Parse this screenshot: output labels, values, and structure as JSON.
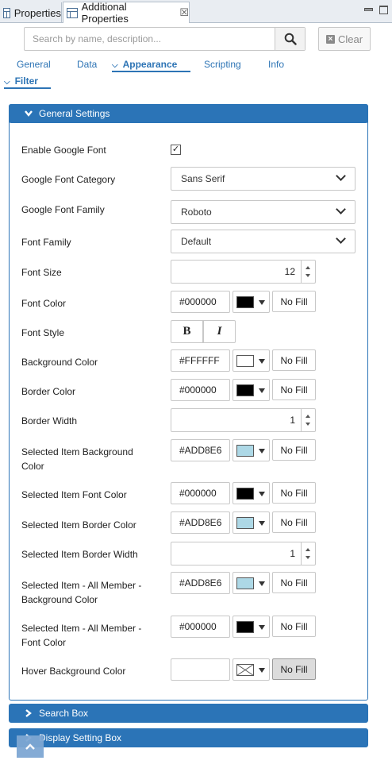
{
  "tabs": [
    {
      "label": "Properties",
      "icon": "properties-icon"
    },
    {
      "label": "Additional Properties",
      "icon": "properties-icon",
      "close": "☒"
    }
  ],
  "search": {
    "placeholder": "Search by name, description...",
    "value": "",
    "clear_label": "Clear"
  },
  "nav": {
    "general": "General",
    "data": "Data",
    "appearance": "Appearance",
    "scripting": "Scripting",
    "info": "Info",
    "filter": "Filter"
  },
  "sections": {
    "general_settings": "General Settings",
    "search_box": "Search Box",
    "display_setting_box": "Display Setting Box"
  },
  "form": {
    "enable_google_font": {
      "label": "Enable Google Font",
      "checked": true,
      "mark": "✓"
    },
    "google_font_category": {
      "label": "Google Font Category",
      "value": "Sans Serif"
    },
    "google_font_family": {
      "label": "Google Font Family",
      "value": "Roboto"
    },
    "font_family": {
      "label": "Font Family",
      "value": "Default"
    },
    "font_size": {
      "label": "Font Size",
      "value": "12"
    },
    "font_color": {
      "label": "Font Color",
      "hex": "#000000",
      "swatch": "#000000",
      "nofill": "No Fill"
    },
    "font_style": {
      "label": "Font Style",
      "bold": "B",
      "italic": "I"
    },
    "background_color": {
      "label": "Background Color",
      "hex": "#FFFFFF",
      "swatch": "#FFFFFF",
      "nofill": "No Fill"
    },
    "border_color": {
      "label": "Border Color",
      "hex": "#000000",
      "swatch": "#000000",
      "nofill": "No Fill"
    },
    "border_width": {
      "label": "Border Width",
      "value": "1"
    },
    "selected_item_bg": {
      "label": "Selected Item Background Color",
      "hex": "#ADD8E6",
      "swatch": "#ADD8E6",
      "nofill": "No Fill"
    },
    "selected_item_font_color": {
      "label": "Selected Item Font Color",
      "hex": "#000000",
      "swatch": "#000000",
      "nofill": "No Fill"
    },
    "selected_item_border_color": {
      "label": "Selected Item Border Color",
      "hex": "#ADD8E6",
      "swatch": "#ADD8E6",
      "nofill": "No Fill"
    },
    "selected_item_border_width": {
      "label": "Selected Item Border Width",
      "value": "1"
    },
    "all_member_bg": {
      "label": "Selected Item - All Member - Background Color",
      "hex": "#ADD8E6",
      "swatch": "#ADD8E6",
      "nofill": "No Fill"
    },
    "all_member_font_color": {
      "label": "Selected Item - All Member - Font Color",
      "hex": "#000000",
      "swatch": "#000000",
      "nofill": "No Fill"
    },
    "hover_bg": {
      "label": "Hover Background Color",
      "hex": "",
      "swatch": "none",
      "nofill": "No Fill",
      "nofill_active": true
    }
  }
}
